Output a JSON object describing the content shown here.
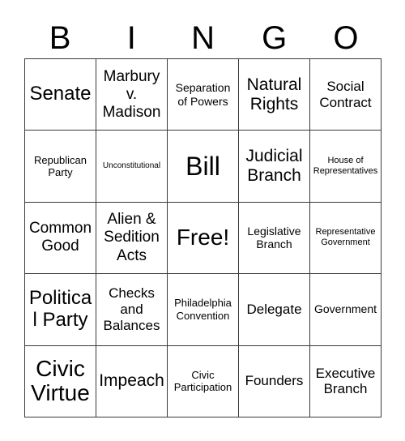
{
  "card": {
    "title_letters": [
      "B",
      "I",
      "N",
      "G",
      "O"
    ],
    "colors": {
      "background": "#ffffff",
      "text": "#000000",
      "grid_line": "#3a3a3a"
    },
    "grid": {
      "columns": 5,
      "rows": 5,
      "free_space": "Free!"
    },
    "cells": [
      {
        "label": "Senate",
        "size": "xl"
      },
      {
        "label": "Marbury v. Madison",
        "size": "ml"
      },
      {
        "label": "Separation of Powers",
        "size": "sm"
      },
      {
        "label": "Natural Rights",
        "size": "l"
      },
      {
        "label": "Social Contract",
        "size": "m"
      },
      {
        "label": "Republican Party",
        "size": "s"
      },
      {
        "label": "Unconstitutional",
        "size": "xxs"
      },
      {
        "label": "Bill",
        "size": "huge"
      },
      {
        "label": "Judicial Branch",
        "size": "l"
      },
      {
        "label": "House of Representatives",
        "size": "xs"
      },
      {
        "label": "Common Good",
        "size": "ml"
      },
      {
        "label": "Alien & Sedition Acts",
        "size": "ml"
      },
      {
        "label": "Free!",
        "size": "xxl"
      },
      {
        "label": "Legislative Branch",
        "size": "sm"
      },
      {
        "label": "Representative Government",
        "size": "xs"
      },
      {
        "label": "Political Party",
        "size": "xl"
      },
      {
        "label": "Checks and Balances",
        "size": "m"
      },
      {
        "label": "Philadelphia Convention",
        "size": "s"
      },
      {
        "label": "Delegate",
        "size": "m"
      },
      {
        "label": "Government",
        "size": "sm"
      },
      {
        "label": "Civic Virtue",
        "size": "xxl"
      },
      {
        "label": "Impeach",
        "size": "l"
      },
      {
        "label": "Civic Participation",
        "size": "s"
      },
      {
        "label": "Founders",
        "size": "m"
      },
      {
        "label": "Executive Branch",
        "size": "m"
      }
    ]
  }
}
